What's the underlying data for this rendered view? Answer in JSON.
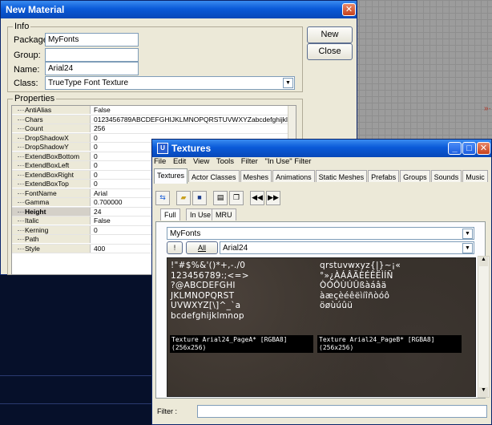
{
  "new_material": {
    "title": "New Material",
    "info_label": "Info",
    "package_label": "Package:",
    "package_value": "MyFonts",
    "group_label": "Group:",
    "group_value": "",
    "name_label": "Name:",
    "name_value": "Arial24",
    "class_label": "Class:",
    "class_value": "TrueType Font Texture",
    "new_button": "New",
    "close_button": "Close",
    "properties_label": "Properties",
    "properties": [
      {
        "name": "AntiAlias",
        "value": "False"
      },
      {
        "name": "Chars",
        "value": " 0123456789ABCDEFGHIJKLMNOPQRSTUVWXYZabcdefghijkl..."
      },
      {
        "name": "Count",
        "value": "256"
      },
      {
        "name": "DropShadowX",
        "value": "0"
      },
      {
        "name": "DropShadowY",
        "value": "0"
      },
      {
        "name": "ExtendBoxBottom",
        "value": "0"
      },
      {
        "name": "ExtendBoxLeft",
        "value": "0"
      },
      {
        "name": "ExtendBoxRight",
        "value": "0"
      },
      {
        "name": "ExtendBoxTop",
        "value": "0"
      },
      {
        "name": "FontName",
        "value": "Arial"
      },
      {
        "name": "Gamma",
        "value": "0.700000"
      },
      {
        "name": "Height",
        "value": "24"
      },
      {
        "name": "Italic",
        "value": "False"
      },
      {
        "name": "Kerning",
        "value": "0"
      },
      {
        "name": "Path",
        "value": ""
      },
      {
        "name": "Style",
        "value": "400"
      }
    ]
  },
  "textures": {
    "title": "Textures",
    "menu": [
      "File",
      "Edit",
      "View",
      "Tools",
      "Filter",
      "\"In Use\" Filter"
    ],
    "tabs": [
      "Textures",
      "Actor Classes",
      "Meshes",
      "Animations",
      "Static Meshes",
      "Prefabs",
      "Groups",
      "Sounds",
      "Music"
    ],
    "subtabs": [
      "Full",
      "In Use",
      "MRU"
    ],
    "package_value": "MyFonts",
    "bang_label": "!",
    "all_label": "All",
    "group_value": "Arial24",
    "page_a_glyphs": "!\"#$%&'()*+,-./0\n123456789:;<=>\n?@ABCDEFGHI\nJKLMNOPQRST\nUVWXYZ[\\]^_`a\nbcdefghijklmnop",
    "page_b_glyphs": "qrstuvwxyz{|}~¡«\n°»¿ÀÁÂÄÈÉÊËÌÍÑ\nÒÓÔÙÚÛßàáâä\nàæçèéêëìíîñòóô\nöøùúûü",
    "page_a_caption": "Texture Arial24_PageA* [RGBA8]\n(256x256)",
    "page_b_caption": "Texture Arial24_PageB* [RGBA8]\n(256x256)",
    "filter_label": "Filter :",
    "filter_value": ""
  }
}
